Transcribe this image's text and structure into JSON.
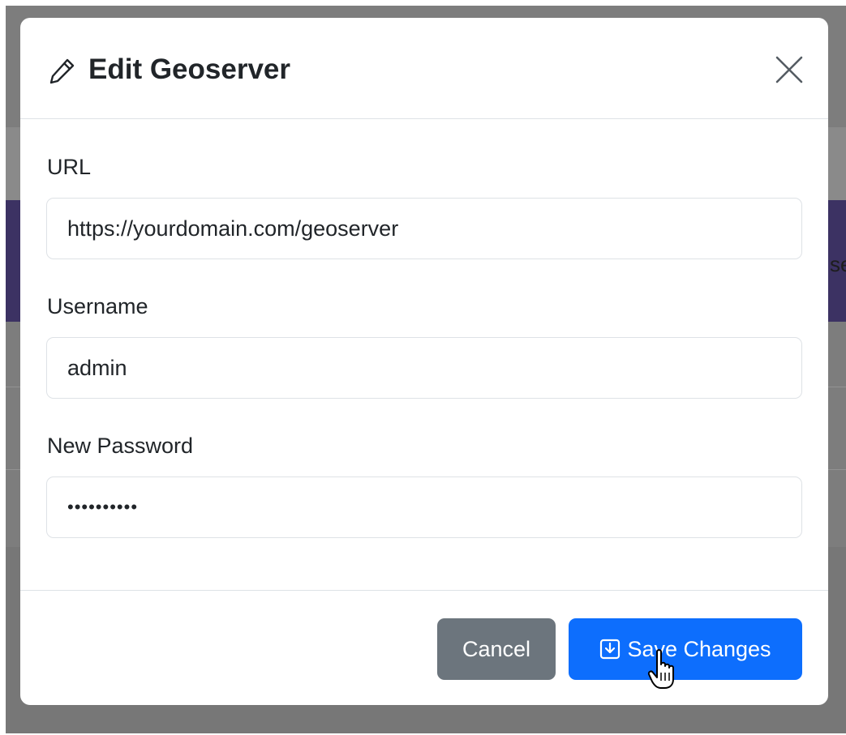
{
  "modal": {
    "title": "Edit Geoserver",
    "icons": {
      "title": "pencil-icon",
      "close": "close-icon",
      "save": "download-box-icon"
    },
    "fields": [
      {
        "label": "URL",
        "value": "https://yourdomain.com/geoserver"
      },
      {
        "label": "Username",
        "value": "admin"
      },
      {
        "label": "New Password",
        "value": "••••••••••"
      }
    ],
    "buttons": {
      "cancel": "Cancel",
      "save": "Save Changes"
    }
  },
  "background": {
    "partial_text": "se"
  },
  "colors": {
    "primary": "#0d6efd",
    "secondary": "#6c757d",
    "backdrop": "#7d7d7d",
    "background_band": "#3c3263"
  }
}
